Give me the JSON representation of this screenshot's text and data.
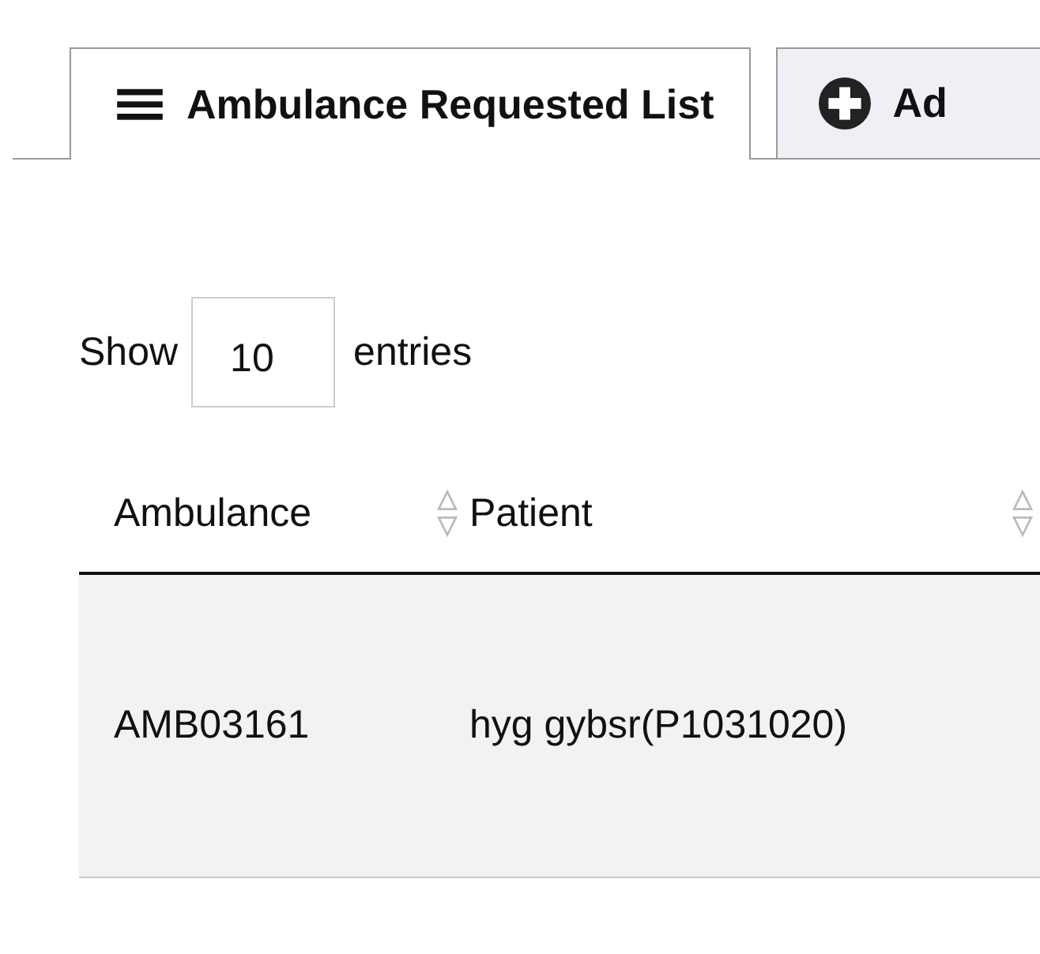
{
  "tabs": [
    {
      "label": "Ambulance Requested List",
      "kind": "list",
      "selected": true
    },
    {
      "label": "Ad",
      "kind": "add",
      "selected": false
    }
  ],
  "length_control": {
    "before": "Show",
    "value": "10",
    "after": "entries"
  },
  "table": {
    "columns": [
      {
        "label": "Ambulance",
        "sortable": true
      },
      {
        "label": "Patient",
        "sortable": true
      }
    ],
    "rows": [
      [
        "AMB03161",
        "hyg gybsr(P1031020)"
      ]
    ]
  }
}
